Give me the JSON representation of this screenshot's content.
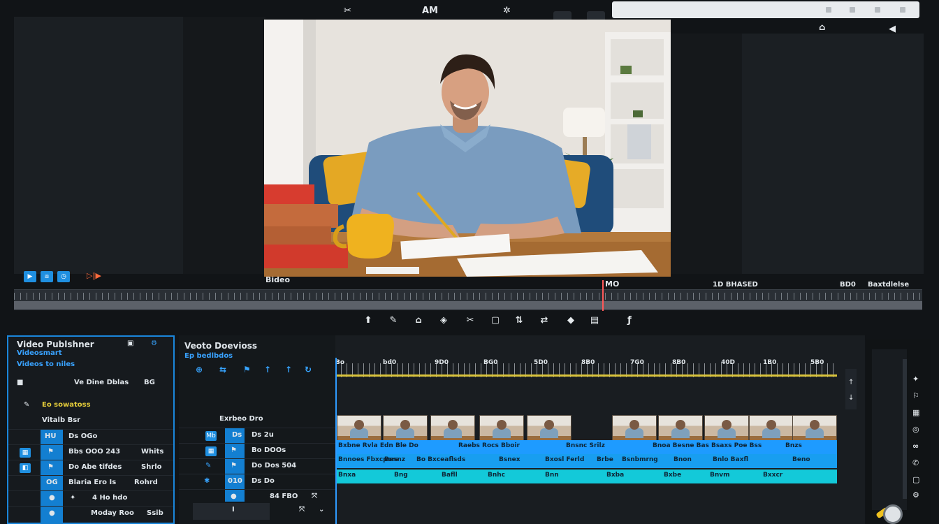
{
  "top_icons": [
    "scissor-icon",
    "text-tool-icon",
    "grid-icon"
  ],
  "top_labels": [
    "AM"
  ],
  "preview_label": "Bideo",
  "transport": {
    "left_text": "▷|▶",
    "mid_marker": "MO",
    "right_text": "1D BHASED",
    "right_text2": "BD0",
    "right_text3": "Baxtdlelse"
  },
  "left_panel": {
    "title": "Video Publshner",
    "subtitle": "Videosmart",
    "subtitle2": "Videos to niles",
    "row1": "Ve Dine Dblas",
    "row1_val": "BG",
    "row2": "Eo sowatoss",
    "row3": "Vitalb Bsr",
    "rows": [
      {
        "a": "HU",
        "b": "Ds OGo",
        "c": ""
      },
      {
        "a": "",
        "b": "Bbs OOO 243",
        "c": "Whits"
      },
      {
        "a": "",
        "b": "Do Abe tifdes",
        "c": "Shrlo"
      },
      {
        "a": "OG",
        "b": "Blaria Ero Is",
        "c": "Rohrd"
      },
      {
        "a": "",
        "b": "4 Ho hdo",
        "c": ""
      },
      {
        "a": "",
        "b": "Moday Roo",
        "c": "Ssib"
      }
    ]
  },
  "mid_panel": {
    "title": "Veoto Doevioss",
    "subtitle": "Ep bedlbdos",
    "row_header": "Exrbeo Dro",
    "rows": [
      {
        "a": "Mb",
        "b": "Ds",
        "c": "Ds 2u"
      },
      {
        "a": "",
        "b": "",
        "c": "Bo DOOs"
      },
      {
        "a": "",
        "b": "",
        "c": "Do Dos 504"
      },
      {
        "a": "",
        "b": "010",
        "c": "Ds Do"
      },
      {
        "a": "",
        "b": "",
        "c": "84 FBO"
      }
    ]
  },
  "timeline": {
    "ruler_labels": [
      "Bo",
      "bd0",
      "9D0",
      "BG0",
      "5D0",
      "8B0",
      "7G0",
      "8B0",
      "40D",
      "1B0",
      "5B0"
    ],
    "track1_labels": [
      "Bxbne Rvla Edn Ble Do",
      "Raebs Rocs Bboir",
      "Bnsnc Srilz",
      "Bnoa Besne Bas Bsaxs Poe Bss",
      "Bnzs"
    ],
    "track2_labels": [
      "Bnnoes Fbxcpore",
      "Besnz",
      "Bo Bxceaflsds",
      "Bsnex",
      "Bxosl Ferld",
      "Brbe",
      "Bsnbmrng",
      "Bnon",
      "Bnlo Baxfl",
      "Beno"
    ],
    "track3_labels": [
      "Bnxa",
      "Bng",
      "Bafll",
      "Bnhc",
      "Bnn",
      "Bxba",
      "Bxbe",
      "Bnvm",
      "Bxxcr"
    ]
  },
  "colors": {
    "accent": "#1f8fe0",
    "track_blue": "#1e9bff",
    "track_cyan": "#13c9d9",
    "playhead": "#2f9bff",
    "marker": "#d9c33b"
  }
}
